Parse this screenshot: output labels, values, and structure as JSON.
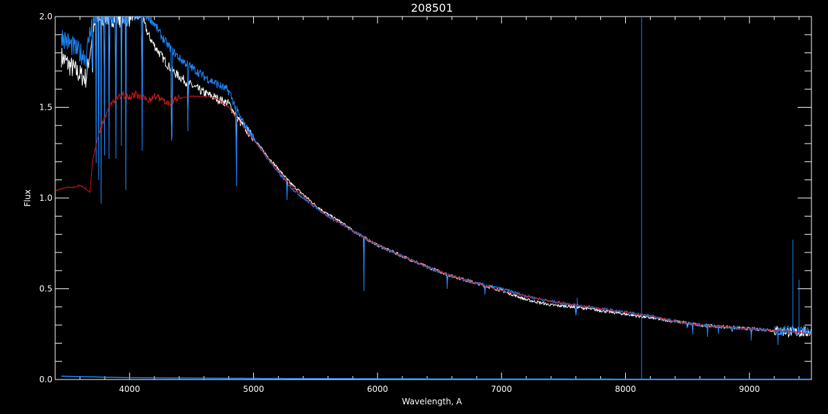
{
  "chart_data": {
    "type": "line",
    "title": "208501",
    "xlabel": "Wavelength, A",
    "ylabel": "Flux",
    "xlim": [
      3400,
      9500
    ],
    "ylim": [
      0.0,
      2.0
    ],
    "x_ticks": [
      4000,
      5000,
      6000,
      7000,
      8000,
      9000
    ],
    "x_tick_labels": [
      "4000",
      "5000",
      "6000",
      "7000",
      "8000",
      "9000"
    ],
    "y_ticks": [
      0.0,
      0.5,
      1.0,
      1.5,
      2.0
    ],
    "y_tick_labels": [
      "0.0",
      "0.5",
      "1.0",
      "1.5",
      "2.0"
    ],
    "grid": false,
    "background": "#000000",
    "axis_color": "#ffffff",
    "series": [
      {
        "color": "#ffffff",
        "x": [
          3450,
          3500,
          3550,
          3600,
          3650,
          3700,
          3750,
          3800,
          3850,
          3900,
          3950,
          4000,
          4050,
          4100,
          4150,
          4200,
          4250,
          4300,
          4350,
          4400,
          4500,
          4600,
          4700,
          4800,
          4900,
          5000,
          5100,
          5200,
          5300,
          5400,
          5500,
          5600,
          5700,
          5800,
          5900,
          6000,
          6200,
          6400,
          6600,
          6800,
          7000,
          7200,
          7400,
          7600,
          7800,
          8000,
          8200,
          8400,
          8600,
          8800,
          9000,
          9200,
          9400,
          9500
        ],
        "y": [
          1.78,
          1.74,
          1.71,
          1.68,
          1.66,
          1.9,
          2.0,
          2.0,
          2.0,
          2.0,
          2.0,
          2.0,
          2.0,
          2.0,
          1.9,
          1.84,
          1.79,
          1.74,
          1.7,
          1.67,
          1.62,
          1.58,
          1.55,
          1.52,
          1.41,
          1.33,
          1.24,
          1.16,
          1.08,
          1.02,
          0.96,
          0.91,
          0.87,
          0.82,
          0.78,
          0.74,
          0.68,
          0.62,
          0.57,
          0.53,
          0.49,
          0.44,
          0.41,
          0.4,
          0.38,
          0.36,
          0.34,
          0.32,
          0.3,
          0.29,
          0.28,
          0.27,
          0.26,
          0.26
        ]
      },
      {
        "color": "#1e88ff",
        "x": [
          3450,
          3500,
          3550,
          3600,
          3650,
          3700,
          3750,
          3800,
          3850,
          3900,
          3950,
          4000,
          4050,
          4100,
          4150,
          4200,
          4250,
          4300,
          4350,
          4400,
          4500,
          4600,
          4700,
          4800,
          4900,
          5000,
          5100,
          5200,
          5300,
          5400,
          5500,
          5600,
          5700,
          5800,
          5900,
          6000,
          6200,
          6400,
          6600,
          6800,
          7000,
          7200,
          7400,
          7600,
          7800,
          8000,
          8200,
          8400,
          8600,
          8800,
          9000,
          9200,
          9400,
          9500
        ],
        "y": [
          1.9,
          1.86,
          1.83,
          1.8,
          1.78,
          2.0,
          2.0,
          2.0,
          2.0,
          2.0,
          2.0,
          2.0,
          2.0,
          2.0,
          2.0,
          1.96,
          1.9,
          1.85,
          1.81,
          1.77,
          1.72,
          1.67,
          1.63,
          1.59,
          1.43,
          1.33,
          1.23,
          1.14,
          1.06,
          1.0,
          0.95,
          0.9,
          0.86,
          0.82,
          0.78,
          0.74,
          0.68,
          0.62,
          0.57,
          0.53,
          0.5,
          0.46,
          0.43,
          0.41,
          0.39,
          0.37,
          0.35,
          0.32,
          0.3,
          0.29,
          0.28,
          0.27,
          0.27,
          0.27
        ]
      },
      {
        "color": "#d01818",
        "x": [
          3400,
          3450,
          3500,
          3550,
          3600,
          3650,
          3680,
          3700,
          3750,
          3800,
          3850,
          3900,
          3950,
          4000,
          4050,
          4100,
          4150,
          4200,
          4250,
          4300,
          4400,
          4500,
          4600,
          4700,
          4800,
          4900,
          5000,
          5100,
          5200,
          5300,
          5400,
          5500,
          5600,
          5700,
          5800,
          5900,
          6000,
          6200,
          6400,
          6600,
          6800,
          7000,
          7200,
          7400,
          7600,
          7800,
          8000,
          8200,
          8400,
          8600,
          8800,
          9000,
          9200,
          9400,
          9500
        ],
        "y": [
          1.04,
          1.05,
          1.06,
          1.06,
          1.07,
          1.05,
          1.03,
          1.2,
          1.35,
          1.45,
          1.52,
          1.55,
          1.57,
          1.56,
          1.57,
          1.55,
          1.54,
          1.56,
          1.55,
          1.52,
          1.55,
          1.56,
          1.56,
          1.55,
          1.5,
          1.41,
          1.32,
          1.23,
          1.15,
          1.07,
          1.01,
          0.95,
          0.9,
          0.86,
          0.82,
          0.78,
          0.74,
          0.68,
          0.62,
          0.57,
          0.53,
          0.49,
          0.46,
          0.43,
          0.41,
          0.39,
          0.37,
          0.35,
          0.32,
          0.3,
          0.29,
          0.28,
          0.27,
          0.26,
          0.25
        ]
      },
      {
        "color": "#1e88ff",
        "x": [
          3450,
          4000,
          5000,
          6000,
          7000,
          8000,
          9000,
          9500
        ],
        "y": [
          0.018,
          0.01,
          0.006,
          0.004,
          0.003,
          0.002,
          0.002,
          0.002
        ]
      }
    ],
    "absorption_lines": [
      {
        "x": 3700,
        "depth": 0.6
      },
      {
        "x": 3730,
        "depth": 0.8
      },
      {
        "x": 3750,
        "depth": 0.9
      },
      {
        "x": 3770,
        "depth": 1.0
      },
      {
        "x": 3797,
        "depth": 1.0
      },
      {
        "x": 3835,
        "depth": 1.1
      },
      {
        "x": 3889,
        "depth": 1.0
      },
      {
        "x": 3934,
        "depth": 0.7
      },
      {
        "x": 3970,
        "depth": 1.0
      },
      {
        "x": 4101,
        "depth": 1.0
      },
      {
        "x": 4340,
        "depth": 1.0
      },
      {
        "x": 4471,
        "depth": 0.5
      },
      {
        "x": 4861,
        "depth": 0.6
      },
      {
        "x": 5270,
        "depth": 0.1
      },
      {
        "x": 5890,
        "depth": 0.3
      },
      {
        "x": 6563,
        "depth": 0.1
      },
      {
        "x": 6867,
        "depth": 0.06
      },
      {
        "x": 7600,
        "depth": 0.1
      },
      {
        "x": 8500,
        "depth": 0.05
      },
      {
        "x": 8542,
        "depth": 0.06
      },
      {
        "x": 8662,
        "depth": 0.06
      },
      {
        "x": 8750,
        "depth": 0.04
      },
      {
        "x": 8860,
        "depth": 0.05
      },
      {
        "x": 9015,
        "depth": 0.08
      },
      {
        "x": 9230,
        "depth": 0.06
      }
    ],
    "spikes": [
      {
        "x": 8130,
        "y": 2.0
      },
      {
        "x": 9350,
        "y": 0.77
      },
      {
        "x": 9400,
        "y": 0.55
      },
      {
        "x": 7610,
        "y": 0.45
      }
    ]
  }
}
